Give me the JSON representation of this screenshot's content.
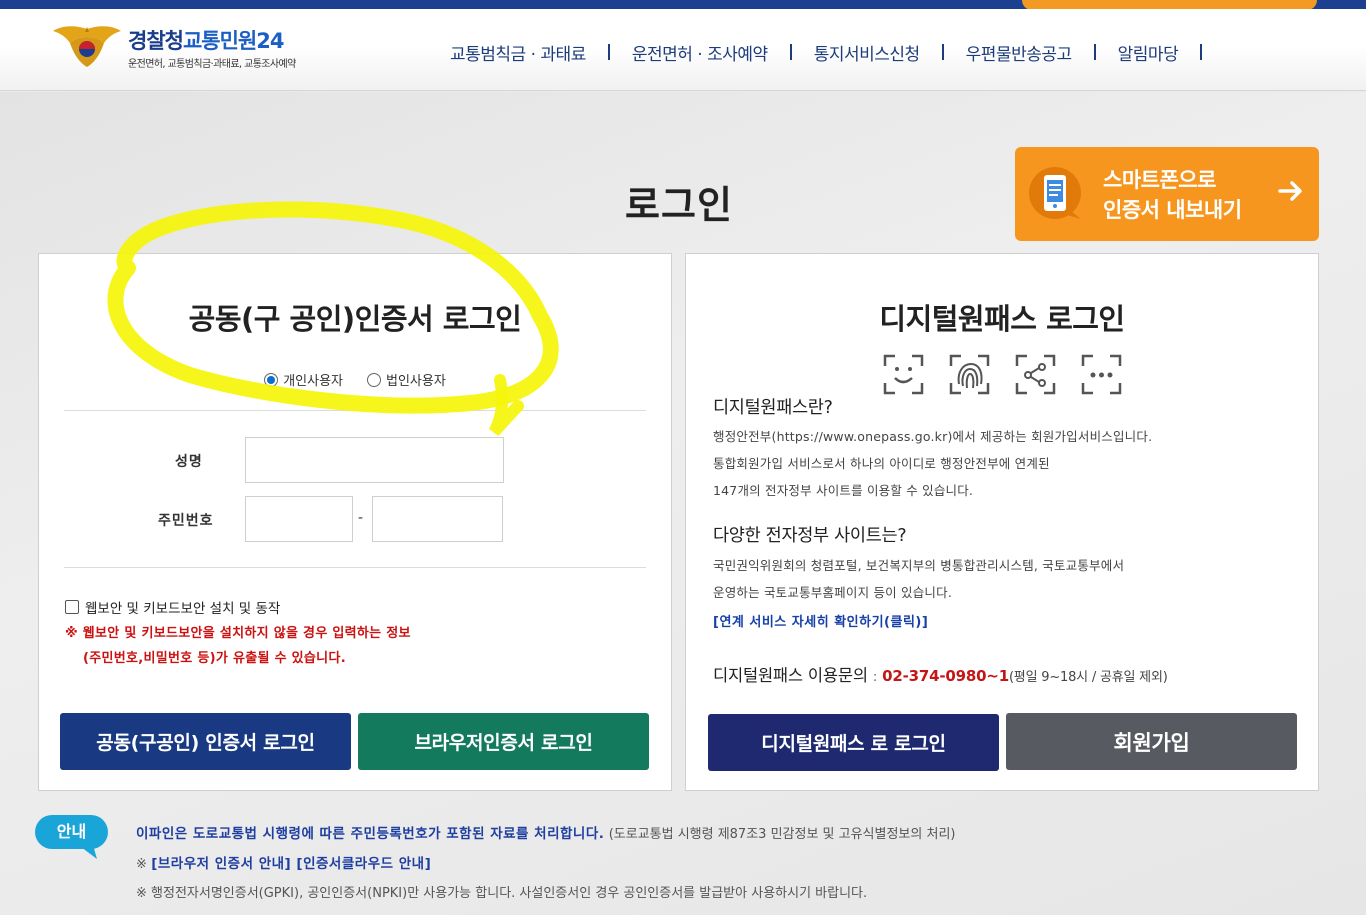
{
  "colors": {
    "navy": "#193a83",
    "green": "#147a5e",
    "orange": "#f6961f",
    "annotation": "#f5f50a"
  },
  "header": {
    "logo_title_1": "경찰청",
    "logo_title_2": "교통민원24",
    "logo_sub": "운전면허, 교통범칙금·과태료, 교통조사예약",
    "nav": [
      "교통범칙금 · 과태료",
      "운전면허 · 조사예약",
      "통지서비스신청",
      "우편물반송공고",
      "알림마당"
    ]
  },
  "page_title": "로그인",
  "smart_export": {
    "line1": "스마트폰으로",
    "line2": "인증서 내보내기",
    "icon": "smartphone-icon"
  },
  "cert_login": {
    "title": "공동(구 공인)인증서 로그인",
    "radio_personal": "개인사용자",
    "radio_corporate": "법인사용자",
    "name_label": "성명",
    "rrn_label": "주민번호",
    "rrn_sep": "-",
    "security_check": "웹보안 및 키보드보안 설치 및 동작",
    "warn_line1": "※ 웹보안 및 키보드보안을 설치하지 않을 경우 입력하는 정보",
    "warn_line2": "(주민번호,비밀번호 등)가 유출될 수 있습니다.",
    "btn_cert": "공동(구공인) 인증서 로그인",
    "btn_browser": "브라우저인증서 로그인"
  },
  "onepass": {
    "title": "디지털원패스 로그인",
    "what_head": "디지털원패스란?",
    "what_1": "행정안전부(https://www.onepass.go.kr)에서 제공하는 회원가입서비스입니다.",
    "what_2": "통합회원가입 서비스로서 하나의 아이디로 행정안전부에 연계된",
    "what_3": "147개의 전자정부 사이트를 이용할 수 있습니다.",
    "sites_head": "다양한 전자정부 사이트는?",
    "sites_1": "국민권익위원회의 청렴포털, 보건복지부의 병통합관리시스템, 국토교통부에서",
    "sites_2": "운영하는 국토교통부홈페이지 등이 있습니다.",
    "link": "[연계 서비스 자세히 확인하기(클릭)]",
    "contact_label": "디지털원패스 이용문의",
    "contact_sep": ":",
    "contact_tel": "02-374-0980~1",
    "contact_hours": "(평일 9~18시 / 공휴일 제외)",
    "btn_login": "디지털원패스 로 로그인",
    "btn_join": "회원가입"
  },
  "notice": {
    "badge": "안내",
    "line1_main": "이파인은 도로교통법 시행령에 따른 주민등록번호가 포함된 자료를 처리합니다.",
    "line1_paren": "(도로교통법 시행령 제87조3 민감정보 및 고유식별정보의 처리)",
    "line2_prefix": "※",
    "line2_link": "[브라우저 인증서 안내] [인증서클라우드 안내]",
    "line3": "※ 행정전자서명인증서(GPKI), 공인인증서(NPKI)만 사용가능 합니다. 사설인증서인 경우 공인인증서를 발급받아 사용하시기 바랍니다."
  }
}
